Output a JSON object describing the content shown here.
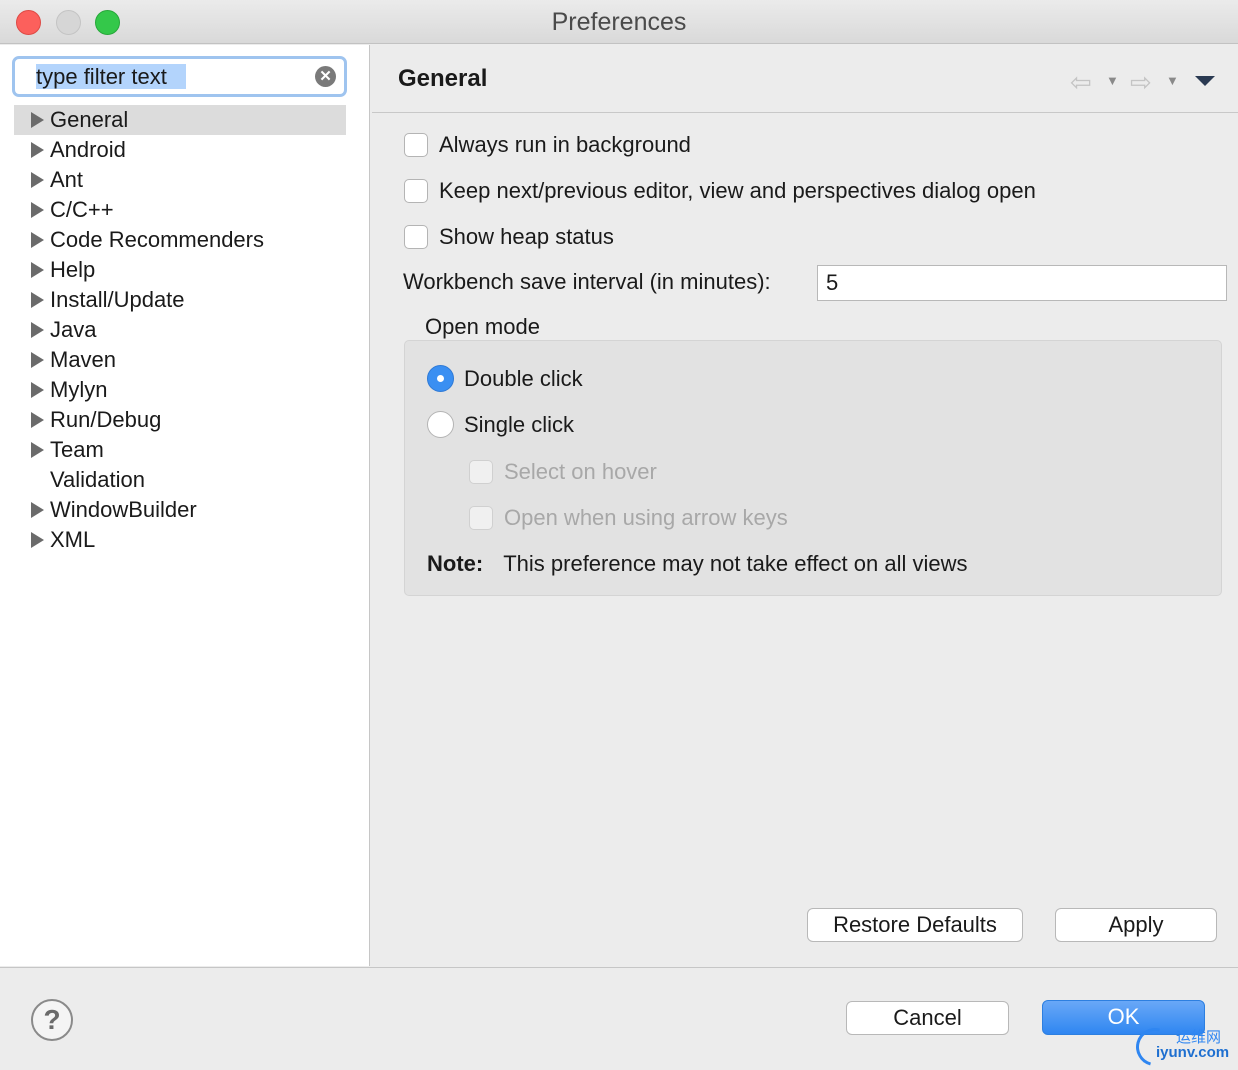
{
  "window": {
    "title": "Preferences"
  },
  "sidebar": {
    "filter_placeholder": "type filter text",
    "items": [
      {
        "label": "General",
        "expandable": true,
        "selected": true
      },
      {
        "label": "Android",
        "expandable": true
      },
      {
        "label": "Ant",
        "expandable": true
      },
      {
        "label": "C/C++",
        "expandable": true
      },
      {
        "label": "Code Recommenders",
        "expandable": true
      },
      {
        "label": "Help",
        "expandable": true
      },
      {
        "label": "Install/Update",
        "expandable": true
      },
      {
        "label": "Java",
        "expandable": true
      },
      {
        "label": "Maven",
        "expandable": true
      },
      {
        "label": "Mylyn",
        "expandable": true
      },
      {
        "label": "Run/Debug",
        "expandable": true
      },
      {
        "label": "Team",
        "expandable": true
      },
      {
        "label": "Validation",
        "expandable": false
      },
      {
        "label": "WindowBuilder",
        "expandable": true
      },
      {
        "label": "XML",
        "expandable": true
      }
    ]
  },
  "main": {
    "title": "General",
    "options": {
      "always_run_background": "Always run in background",
      "keep_dialog_open": "Keep next/previous editor, view and perspectives dialog open",
      "show_heap_status": "Show heap status"
    },
    "interval_label": "Workbench save interval (in minutes):",
    "interval_value": "5",
    "open_mode": {
      "label": "Open mode",
      "double_click": "Double click",
      "single_click": "Single click",
      "select_on_hover": "Select on hover",
      "open_arrow_keys": "Open when using arrow keys",
      "note_label": "Note:",
      "note_text": "This preference may not take effect on all views"
    },
    "restore_defaults_label": "Restore Defaults",
    "apply_label": "Apply"
  },
  "footer": {
    "help_icon": "?",
    "cancel_label": "Cancel",
    "ok_label": "OK"
  },
  "watermark": {
    "cn": "运维网",
    "url": "iyunv.com"
  },
  "colors": {
    "accent": "#3a8ff2",
    "ok_button": "#2f86f1",
    "close": "#fc605c",
    "maximize": "#34c84a"
  }
}
